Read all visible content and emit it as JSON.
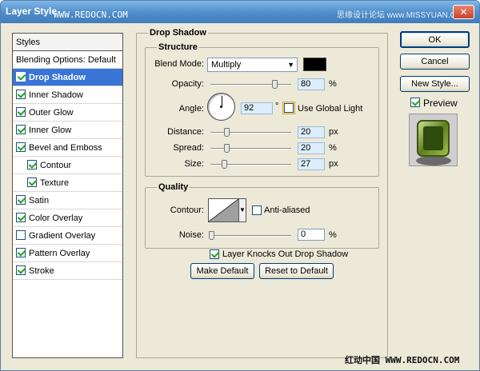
{
  "window": {
    "title": "Layer Style",
    "url_overlay": "WWW.REDOCN.COM",
    "right_overlay": "思缘设计论坛 www.MISSYUAN.COM",
    "close_icon": "close-icon"
  },
  "sidebar": {
    "header": "Styles",
    "blending": "Blending Options: Default",
    "items": [
      {
        "label": "Drop Shadow",
        "checked": true,
        "selected": true,
        "sub": false
      },
      {
        "label": "Inner Shadow",
        "checked": true,
        "selected": false,
        "sub": false
      },
      {
        "label": "Outer Glow",
        "checked": true,
        "selected": false,
        "sub": false
      },
      {
        "label": "Inner Glow",
        "checked": true,
        "selected": false,
        "sub": false
      },
      {
        "label": "Bevel and Emboss",
        "checked": true,
        "selected": false,
        "sub": false
      },
      {
        "label": "Contour",
        "checked": true,
        "selected": false,
        "sub": true
      },
      {
        "label": "Texture",
        "checked": true,
        "selected": false,
        "sub": true
      },
      {
        "label": "Satin",
        "checked": true,
        "selected": false,
        "sub": false
      },
      {
        "label": "Color Overlay",
        "checked": true,
        "selected": false,
        "sub": false
      },
      {
        "label": "Gradient Overlay",
        "checked": false,
        "selected": false,
        "sub": false
      },
      {
        "label": "Pattern Overlay",
        "checked": true,
        "selected": false,
        "sub": false
      },
      {
        "label": "Stroke",
        "checked": true,
        "selected": false,
        "sub": false
      }
    ]
  },
  "drop_shadow": {
    "title": "Drop Shadow",
    "structure": {
      "title": "Structure",
      "blend_mode_label": "Blend Mode:",
      "blend_mode_value": "Multiply",
      "shadow_color": "#000000",
      "opacity_label": "Opacity:",
      "opacity_value": "80",
      "opacity_unit": "%",
      "opacity_level": 0.8,
      "angle_label": "Angle:",
      "angle_value": "92",
      "angle_unit": "°",
      "use_global_light_label": "Use Global Light",
      "use_global_light_checked": false,
      "distance_label": "Distance:",
      "distance_value": "20",
      "distance_unit": "px",
      "spread_label": "Spread:",
      "spread_value": "20",
      "spread_unit": "%",
      "size_label": "Size:",
      "size_value": "27",
      "size_unit": "px"
    },
    "quality": {
      "title": "Quality",
      "contour_label": "Contour:",
      "anti_aliased_label": "Anti-aliased",
      "anti_aliased_checked": false,
      "noise_label": "Noise:",
      "noise_value": "0",
      "noise_unit": "%"
    },
    "knockout_label": "Layer Knocks Out Drop Shadow",
    "knockout_checked": true,
    "make_default_label": "Make Default",
    "reset_default_label": "Reset to Default"
  },
  "actions": {
    "ok_label": "OK",
    "cancel_label": "Cancel",
    "new_style_label": "New Style...",
    "preview_label": "Preview",
    "preview_checked": true
  },
  "footer_watermark": "红动中国 WWW.REDOCN.COM"
}
